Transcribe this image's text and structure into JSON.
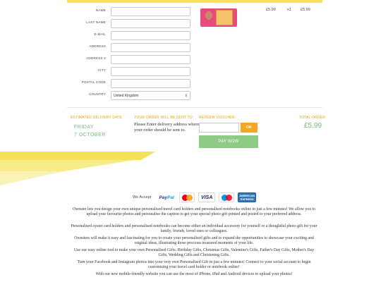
{
  "form": {
    "fields": [
      {
        "label": "NAME",
        "value": ""
      },
      {
        "label": "LAST NAME",
        "value": ""
      },
      {
        "label": "E-MAIL",
        "value": ""
      },
      {
        "label": "ADDRESS",
        "value": ""
      },
      {
        "label": "ADDRESS 2",
        "value": ""
      },
      {
        "label": "CITY",
        "value": ""
      },
      {
        "label": "POSTAL CODE",
        "value": ""
      }
    ],
    "country": {
      "label": "COUNTRY",
      "value": "United Kingdom"
    }
  },
  "order_item": {
    "unit_price": "£5.99",
    "quantity": "x1",
    "line_total": "£5.99"
  },
  "summary": {
    "delivery_heading": "ESTIMATED DELIVERY DATE",
    "delivery_day": "FRIDAY",
    "delivery_date": "7 OCTOBER",
    "sent_heading": "YOUR ORDER WILL BE SENT TO:",
    "sent_text": "Please Enter delivery address where your order should be sent to.",
    "voucher_heading": "REDEEM VOUCHER",
    "voucher_placeholder": "",
    "ok_label": "OK",
    "pay_label": "PAY NOW",
    "total_heading": "TOTAL ORDER",
    "total_value": "£5.99"
  },
  "payment": {
    "we_accept": "We Accept",
    "logos": [
      "paypal-icon",
      "mastercard-icon",
      "visa-icon",
      "maestro-icon",
      "american-express-icon"
    ],
    "paypal_text_1": "Pay",
    "paypal_text_2": "Pal",
    "visa_text": "VISA",
    "amex_text": "AMERICAN EXPRESS"
  },
  "paragraphs": [
    "Ownster lets you design your own unique personalised travel card holders and personalised notebooks online in just a few minutes! We allow you to upload your favourite photos and personalise the caption to get your special photo gift printed and posted to your preferred address.",
    "Personalised oyster card holders and personalised notebooks can become either an individual accessory for yourself or a thoughtful photo gift for your family, friends, loved ones or colleagues.",
    "Ownsters will make it easy and fascinating for you to create your personalised gifts and to expand the opportunities to showcase your exciting and original ideas, illustrating those precious treasured moments of your life.",
    "Use our easy online tool to make your own Personalised Gifts: Birthday Gifts, Christmas Gifts, Valentine's Gifts, Father's Day Gifts, Mother's Day Gifts, Wedding Gifts and Christening Gifts.",
    "Turn your Facebook and Instagram photos into your very own Personalised Gift in just a few minutes! Connect to your social account to begin customising your travel card holder or notebook online!",
    "With our new mobile-friendly website you can use the most of iPhone, iPad and Android devices to upload your photos!"
  ],
  "colors": {
    "accent_yellow": "#f5e25a",
    "heading_orange": "#e2a51a",
    "green": "#7cb97d",
    "ok_orange": "#f5a623",
    "card_pink": "#e74a7b"
  }
}
